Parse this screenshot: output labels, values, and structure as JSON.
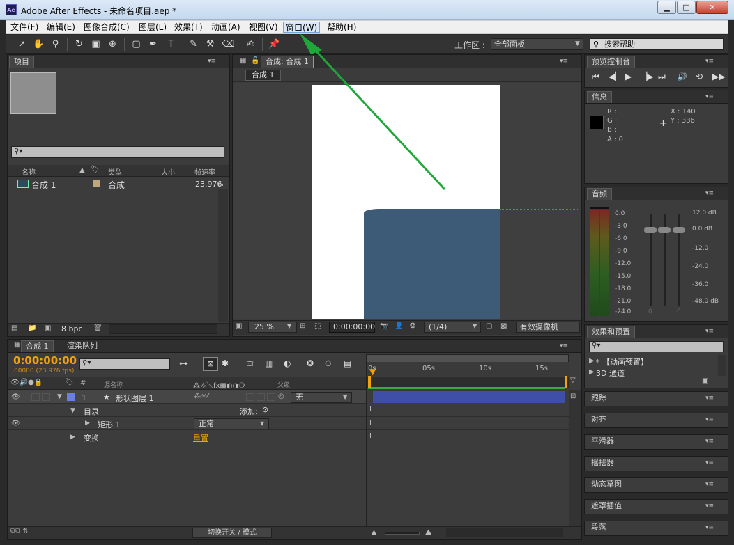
{
  "window": {
    "title": "Adobe After Effects - 未命名项目.aep *",
    "app_icon": "Ae",
    "minimize": "▁",
    "maximize": "□",
    "close": "✕"
  },
  "menu": [
    "文件(F)",
    "编辑(E)",
    "图像合成(C)",
    "图层(L)",
    "效果(T)",
    "动画(A)",
    "视图(V)",
    "窗口(W)",
    "帮助(H)"
  ],
  "toolbar": {
    "workspace_label": "工作区 :",
    "workspace_value": "全部面板",
    "search_placeholder": "搜索帮助"
  },
  "project": {
    "tab": "项目",
    "columns": [
      "名称",
      "类型",
      "大小",
      "帧速率"
    ],
    "item": {
      "name": "合成 1",
      "type": "合成",
      "fps": "23.976"
    },
    "bpc": "8 bpc"
  },
  "composition": {
    "tab": "合成: 合成 1",
    "subtab": "合成 1",
    "zoom": "25 %",
    "timecode": "0:00:00:00",
    "resolution": "(1/4)",
    "camera": "有效摄像机"
  },
  "preview": {
    "tab": "预览控制台"
  },
  "info": {
    "tab": "信息",
    "r": "R :",
    "g": "G :",
    "b": "B :",
    "a": "A : 0",
    "x": "X : 140",
    "y": "Y : 336"
  },
  "audio": {
    "tab": "音频",
    "left_scale": [
      "0.0",
      "-3.0",
      "-6.0",
      "-9.0",
      "-12.0",
      "-15.0",
      "-18.0",
      "-21.0",
      "-24.0"
    ],
    "right_scale": [
      "12.0 dB",
      "0.0 dB",
      "-12.0",
      "-24.0",
      "-36.0",
      "-48.0 dB"
    ],
    "zero_l": "0",
    "zero_r": "0"
  },
  "effects": {
    "tab": "效果和预置",
    "items": [
      "* 【动画预置】",
      "3D 通道"
    ]
  },
  "side_panels": [
    "跟踪",
    "对齐",
    "平滑器",
    "摇摆器",
    "动态草图",
    "遮罩插值",
    "段落"
  ],
  "timeline": {
    "tab": "合成 1",
    "tab2": "渲染队列",
    "timecode": "0:00:00:00",
    "fps_info": "00000 (23.976 fps)",
    "header": {
      "hash": "#",
      "source": "源名称",
      "parent": "父级"
    },
    "ruler": [
      "0s",
      "05s",
      "10s",
      "15s"
    ],
    "layer": {
      "index": "1",
      "name": "形状图层 1",
      "parent": "无"
    },
    "contents": "目录",
    "add": "添加:",
    "rect": "矩形 1",
    "blend": "正常",
    "transform": "变换",
    "reset": "重置",
    "footer": "切换开关 / 模式"
  },
  "colors": {
    "accent": "#f0a30a",
    "layer": "#3f4fa8",
    "shape": "#3d5a76",
    "arrow": "#1fa83a"
  }
}
